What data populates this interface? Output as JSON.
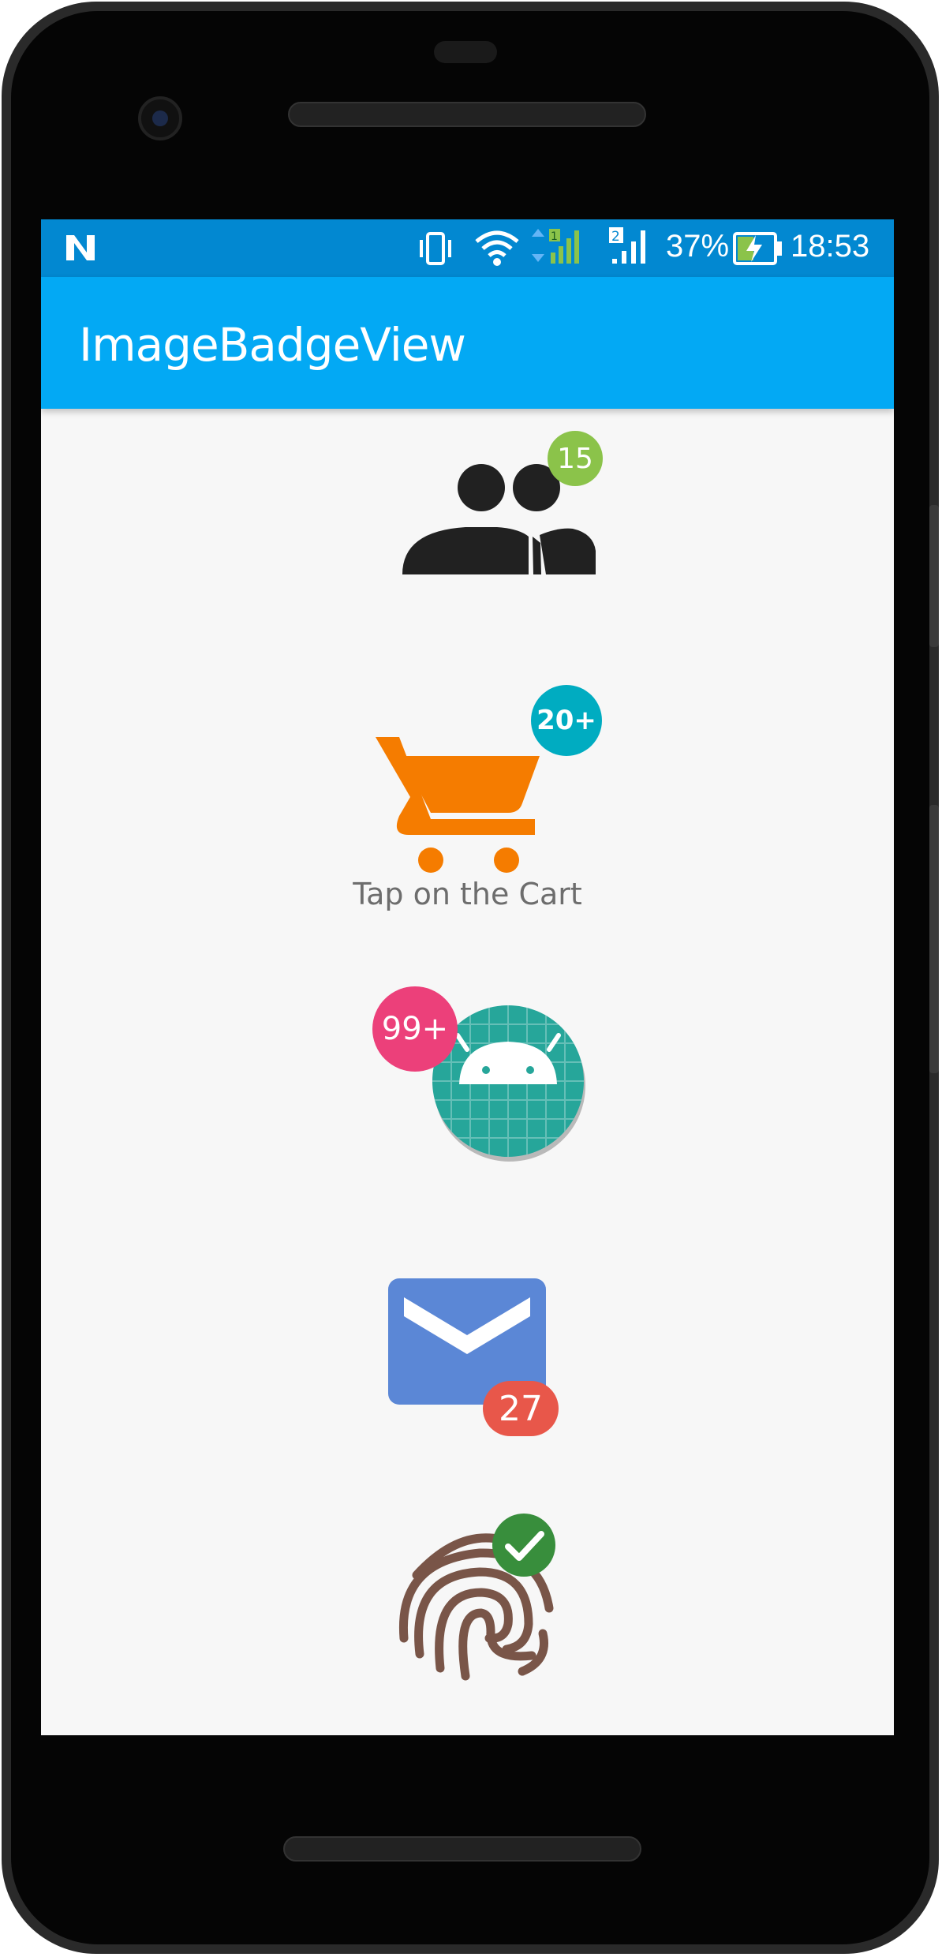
{
  "status_bar": {
    "notification_icon": "n-letter-icon",
    "battery_percent": "37%",
    "time": "18:53",
    "sim1_label": "1",
    "sim2_label": "2",
    "colors": {
      "background": "#0288d1"
    }
  },
  "app_bar": {
    "title": "ImageBadgeView",
    "colors": {
      "background": "#03a9f4"
    }
  },
  "items": [
    {
      "icon": "people-icon",
      "badge": "15",
      "badge_color": "#8bc34a"
    },
    {
      "icon": "cart-icon",
      "badge": "20+",
      "badge_color": "#00acc1",
      "caption": "Tap on the Cart"
    },
    {
      "icon": "android-app-icon",
      "badge": "99+",
      "badge_color": "#ec407a"
    },
    {
      "icon": "mail-icon",
      "badge": "27",
      "badge_color": "#e8574a"
    },
    {
      "icon": "fingerprint-icon",
      "badge": "check-icon",
      "badge_color": "#388e3c"
    }
  ]
}
